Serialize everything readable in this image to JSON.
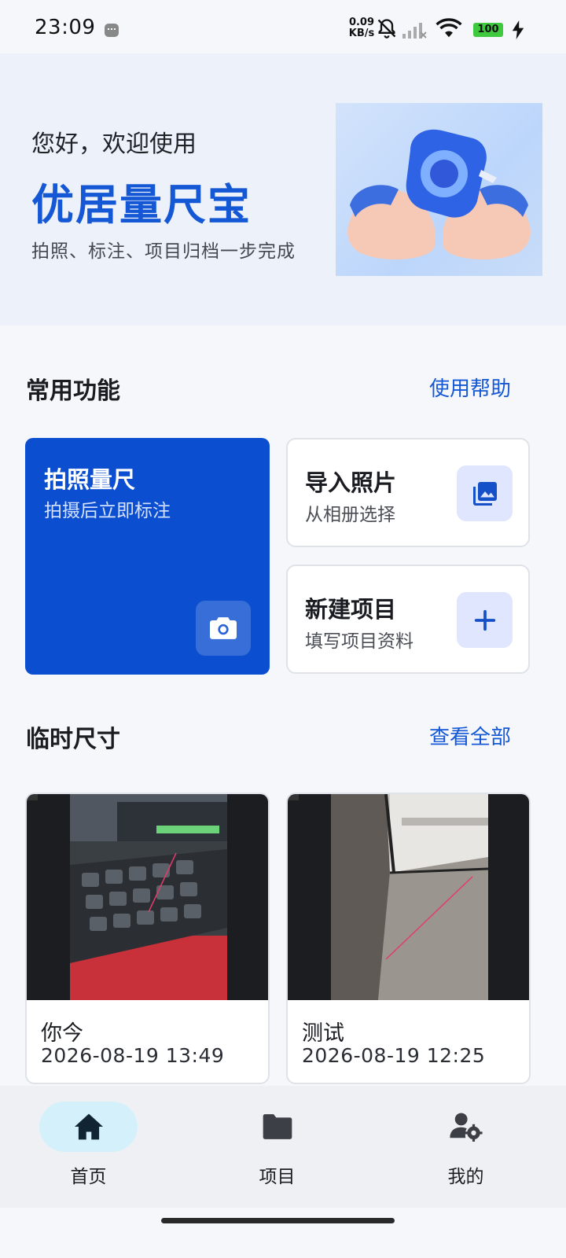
{
  "status_bar": {
    "time": "23:09",
    "net_speed_value": "0.09",
    "net_speed_unit": "KB/s",
    "battery": "100",
    "icons": [
      "app-notification-icon",
      "bell-off-icon",
      "signal-icon",
      "wifi-icon",
      "battery-icon",
      "charging-bolt-icon"
    ]
  },
  "hero": {
    "greeting": "您好，欢迎使用",
    "title": "优居量尺宝",
    "subtitle": "拍照、标注、项目归档一步完成",
    "illustration": "tape-measure-hands-illustration"
  },
  "features": {
    "section_title": "常用功能",
    "help_link": "使用帮助",
    "take_photo": {
      "title": "拍照量尺",
      "subtitle": "拍摄后立即标注",
      "icon": "camera-icon"
    },
    "import_photo": {
      "title": "导入照片",
      "subtitle": "从相册选择",
      "icon": "gallery-icon"
    },
    "new_project": {
      "title": "新建项目",
      "subtitle": "填写项目资料",
      "icon": "plus-icon"
    }
  },
  "recent": {
    "section_title": "临时尺寸",
    "view_all_link": "查看全部",
    "items": [
      {
        "name": "你今",
        "date": "2026-08-19 13:49"
      },
      {
        "name": "测试",
        "date": "2026-08-19 12:25"
      }
    ]
  },
  "bottom_nav": {
    "items": [
      {
        "label": "首页",
        "icon": "home-icon",
        "active": true
      },
      {
        "label": "项目",
        "icon": "folder-icon",
        "active": false
      },
      {
        "label": "我的",
        "icon": "user-settings-icon",
        "active": false
      }
    ]
  },
  "colors": {
    "primary": "#0b4fd0",
    "brand_text": "#1558d6",
    "hero_bg": "#edf1f9",
    "page_bg": "#f6f7fa",
    "active_nav_pill": "#d4f1fb",
    "icon_tile_bg": "#dfe6fd"
  }
}
